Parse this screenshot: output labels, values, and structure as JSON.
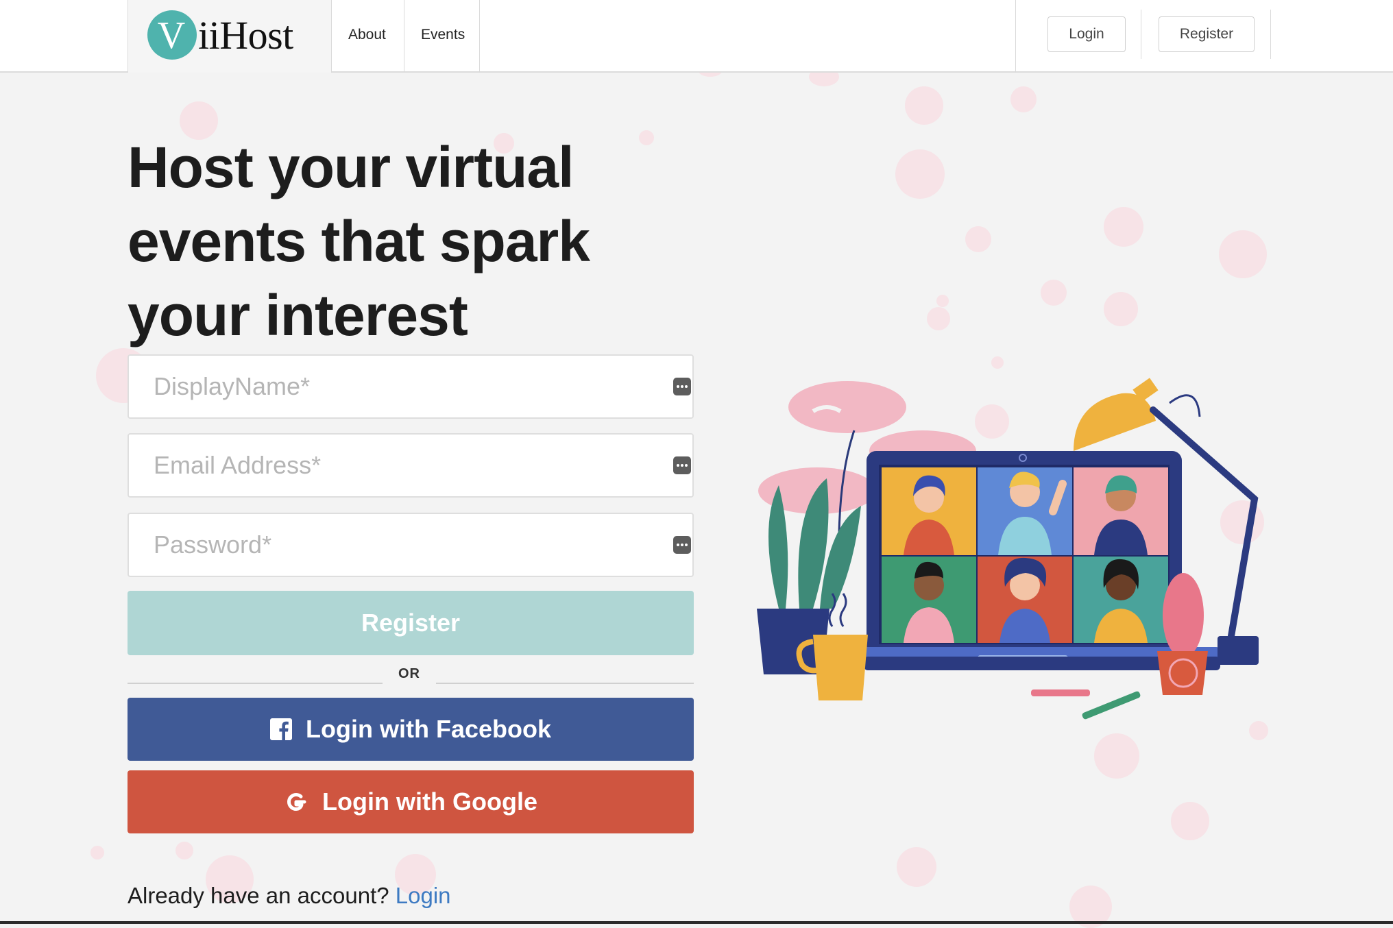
{
  "header": {
    "brand_initial": "V",
    "brand_text": "iiHost",
    "nav": [
      {
        "label": "About"
      },
      {
        "label": "Events"
      }
    ],
    "login_label": "Login",
    "register_label": "Register"
  },
  "hero": {
    "headline_lines": [
      "Host your virtual",
      "events that spark",
      "your interest"
    ]
  },
  "form": {
    "display_name": {
      "placeholder": "DisplayName*",
      "value": ""
    },
    "email": {
      "placeholder": "Email Address*",
      "value": ""
    },
    "password": {
      "placeholder": "Password*",
      "value": ""
    },
    "register_label": "Register",
    "or_label": "OR",
    "facebook_label": "Login with Facebook",
    "google_label": "Login with Google",
    "already_text": "Already have an account?",
    "login_link": "Login"
  },
  "colors": {
    "accent_teal": "#4fb3ad",
    "register_button": "#afd6d4",
    "facebook": "#405a96",
    "google": "#cf5540",
    "link": "#3d7ac2"
  },
  "icons": {
    "field_icon": "password-manager-key-icon",
    "facebook_icon": "facebook-icon",
    "google_icon": "google-icon"
  }
}
